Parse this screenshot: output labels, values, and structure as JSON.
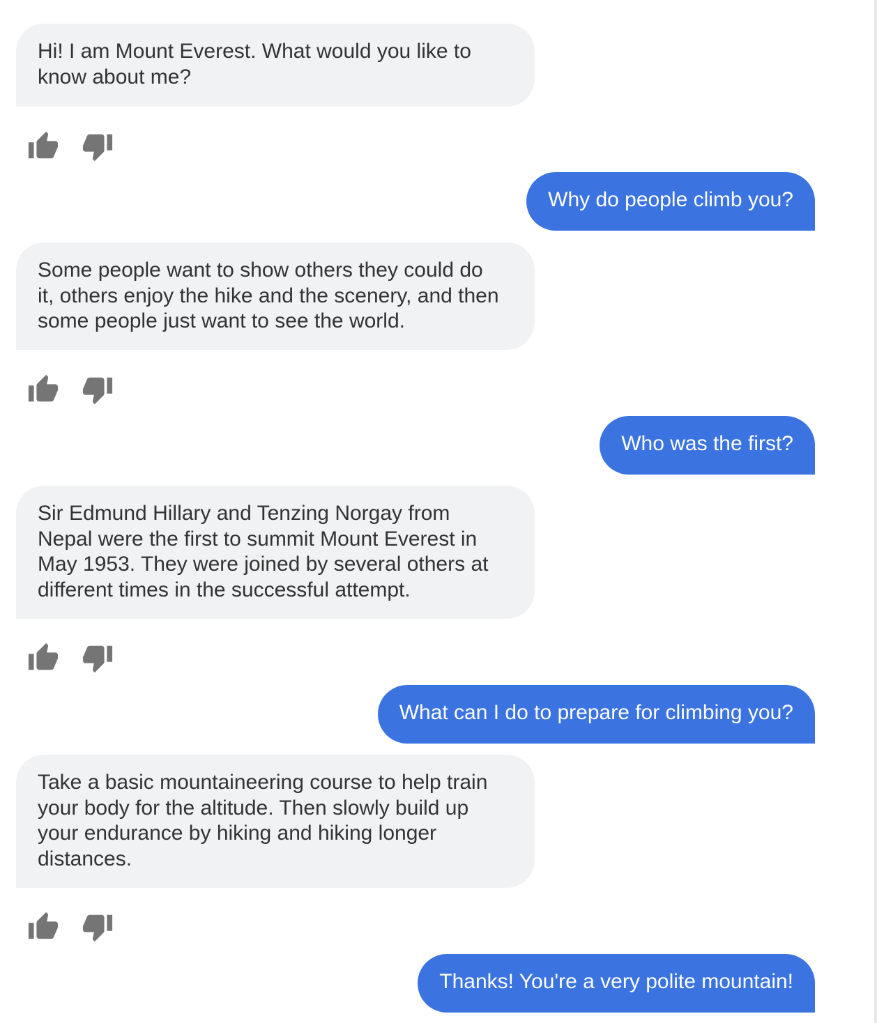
{
  "conversation": {
    "messages": [
      {
        "role": "bot",
        "text": "Hi! I am Mount Everest. What would you like to\nknow about me?"
      },
      {
        "role": "user",
        "text": "Why do people climb you?"
      },
      {
        "role": "bot",
        "text": "Some people want to show others they could do\nit, others enjoy the hike and the scenery, and then\nsome people just want to see the world."
      },
      {
        "role": "user",
        "text": "Who was the first?"
      },
      {
        "role": "bot",
        "text": "Sir Edmund Hillary and Tenzing Norgay from\nNepal were the first to summit Mount Everest in\nMay 1953. They were joined by several others at\ndifferent times in the successful attempt."
      },
      {
        "role": "user",
        "text": "What can I do to prepare for climbing you?"
      },
      {
        "role": "bot",
        "text": "Take a basic mountaineering course to help train\nyour body for the altitude. Then slowly build up\nyour endurance by hiking and hiking longer\ndistances."
      },
      {
        "role": "user",
        "text": "Thanks! You're a very polite mountain!"
      }
    ]
  },
  "feedback": {
    "like_icon": "thumbs-up-icon",
    "dislike_icon": "thumbs-down-icon"
  },
  "colors": {
    "bot_bubble": "#f1f2f4",
    "bot_text": "#333333",
    "user_bubble": "#3b73e0",
    "user_text": "#ffffff",
    "feedback_icon": "#757575"
  }
}
